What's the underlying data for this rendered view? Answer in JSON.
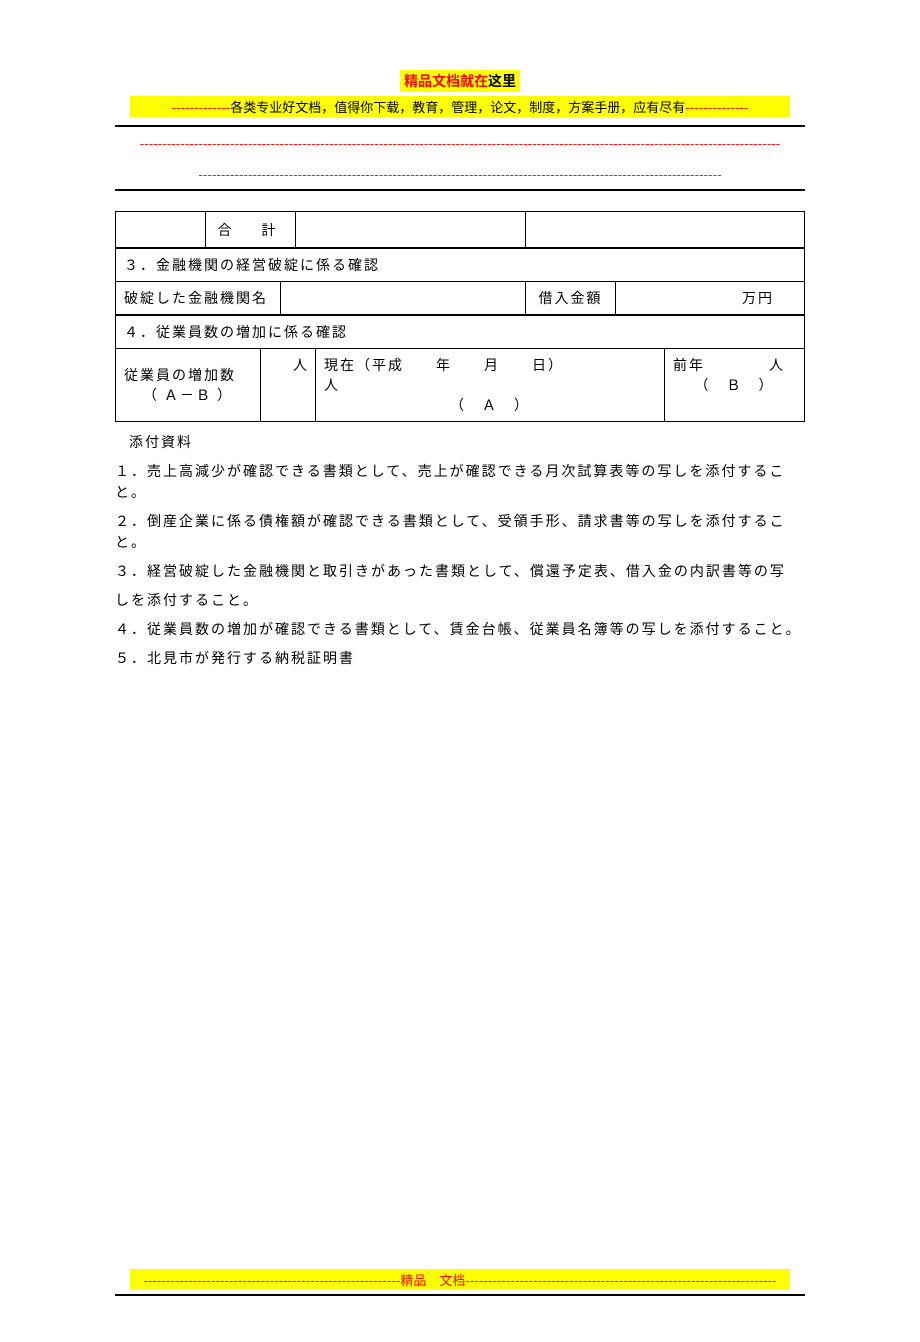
{
  "header": {
    "title_red": "精品文档就在",
    "title_tail": "这里",
    "subtitle_dashes_left": "-------------",
    "subtitle_text": "各类专业好文档，值得你下载，教育，管理，论文，制度，方案手册，应有尽有",
    "subtitle_dashes_right": "--------------",
    "dash_line": "----------------------------------------------------------------------------------------------------------------------------------------------",
    "dash_line2": "--------------------------------------------------------------------------------------------------------------------"
  },
  "table_top": {
    "goukei": "合　計"
  },
  "section3": {
    "title": "３．金融機関の経営破綻に係る確認",
    "name_label": "破綻した金融機関名",
    "amount_label": "借入金額",
    "amount_unit": "万円"
  },
  "section4": {
    "title": "４．従業員数の増加に係る確認",
    "increase_label": "従業員の増加数",
    "increase_sub": "（ Ａ－Ｂ ）",
    "unit_person": "人",
    "current_label": "現在（平成　　年　　月　　日）",
    "current_sub1": "人",
    "current_sub2": "（　Ａ　）",
    "prev_label": "前年　　　　人",
    "prev_sub": "（　Ｂ　）"
  },
  "notes": {
    "heading": "添付資料",
    "n1": "１．売上高減少が確認できる書類として、売上が確認できる月次試算表等の写しを添付すること。",
    "n2": "２．倒産企業に係る債権額が確認できる書類として、受領手形、請求書等の写しを添付すること。",
    "n3a": "３．経営破綻した金融機関と取引きがあった書類として、償還予定表、借入金の内訳書等の写",
    "n3b": "しを添付すること。",
    "n4": "４．従業員数の増加が確認できる書類として、賃金台帳、従業員名簿等の写しを添付すること。",
    "n5": "５．北見市が発行する納税証明書"
  },
  "footer": {
    "dashes_left": "---------------------------------------------------------",
    "label": "精品　文档",
    "dashes_right": "---------------------------------------------------------------------"
  }
}
